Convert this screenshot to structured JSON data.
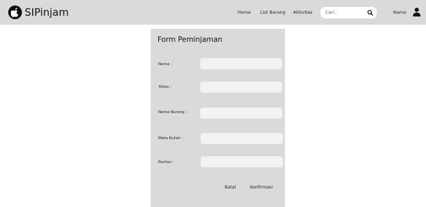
{
  "app": {
    "name": "SIPinjam"
  },
  "nav": {
    "home": "Home",
    "list_barang": "List Barang",
    "aktivitas": "Aktivitas"
  },
  "search": {
    "placeholder": "Cari.."
  },
  "user": {
    "name": "Nama"
  },
  "form": {
    "title": "Form Peminjaman",
    "fields": [
      {
        "label": "Nama :",
        "value": ""
      },
      {
        "label": "Kelas :",
        "value": ""
      },
      {
        "label": "Nama Barang :",
        "value": ""
      },
      {
        "label": "Mata Kuliah :",
        "value": ""
      },
      {
        "label": "Perihal :",
        "value": ""
      }
    ],
    "cancel_label": "Batal",
    "confirm_label": "Konfirmasi"
  },
  "colors": {
    "navbar": "#dadada",
    "panel": "#dadada",
    "input": "#f2f2f2",
    "logo": "#111111"
  }
}
